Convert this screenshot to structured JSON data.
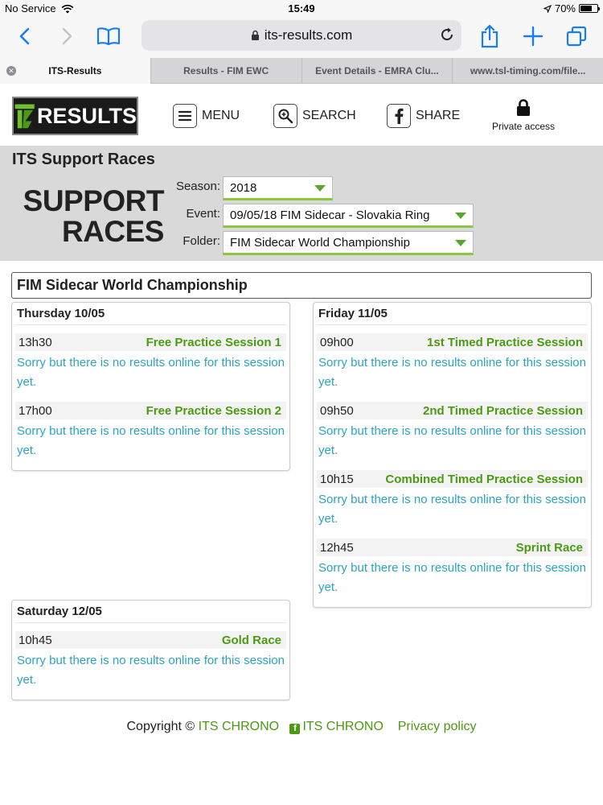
{
  "status_bar": {
    "carrier": "No Service",
    "time": "15:49",
    "battery": "70%",
    "battery_level": 0.7
  },
  "browser": {
    "url": "its-results.com",
    "tabs": [
      {
        "label": "ITS-Results",
        "active": true
      },
      {
        "label": "Results - FIM EWC",
        "active": false
      },
      {
        "label": "Event Details - EMRA Clu...",
        "active": false
      },
      {
        "label": "www.tsl-timing.com/file...",
        "active": false
      }
    ]
  },
  "header": {
    "logo_text": "RESULTS",
    "menu_label": "MENU",
    "search_label": "SEARCH",
    "share_label": "SHARE",
    "private_label": "Private access"
  },
  "section": {
    "title": "ITS Support Races",
    "big_title_line1": "SUPPORT",
    "big_title_line2": "RACES",
    "season_label": "Season:",
    "season_value": "2018",
    "event_label": "Event:",
    "event_value": "09/05/18 FIM Sidecar - Slovakia Ring",
    "folder_label": "Folder:",
    "folder_value": "FIM Sidecar World Championship"
  },
  "championship": "FIM Sidecar World Championship",
  "no_results_text": "Sorry but there is no results online for this session yet.",
  "days": {
    "thursday": {
      "title": "Thursday 10/05",
      "sessions": [
        {
          "time": "13h30",
          "name": "Free Practice Session 1",
          "message": "Sorry but there is no results online for this session yet."
        },
        {
          "time": "17h00",
          "name": "Free Practice Session 2",
          "message": "Sorry but there is no results online for this session yet."
        }
      ]
    },
    "friday": {
      "title": "Friday 11/05",
      "sessions": [
        {
          "time": "09h00",
          "name": "1st Timed Practice Session",
          "message": "Sorry but there is no results online for this session yet."
        },
        {
          "time": "09h50",
          "name": "2nd Timed Practice Session",
          "message": "Sorry but there is no results online for this session yet."
        },
        {
          "time": "10h15",
          "name": "Combined Timed Practice Session",
          "message": "Sorry but there is no results online for this session yet."
        },
        {
          "time": "12h45",
          "name": "Sprint Race",
          "message": "Sorry but there is no results online for this session yet."
        }
      ]
    },
    "saturday": {
      "title": "Saturday 12/05",
      "sessions": [
        {
          "time": "10h45",
          "name": "Gold Race",
          "message": "Sorry but there is no results online for this session yet."
        }
      ]
    }
  },
  "footer": {
    "copyright": "Copyright ©",
    "link1": "ITS CHRONO",
    "link2": "ITS CHRONO",
    "link3": "Privacy policy"
  },
  "colors": {
    "accent_green": "#4c9a13",
    "message_blue": "#2aa3c4",
    "select_underline": "#8dc63f",
    "ios_blue": "#1a7cf5"
  }
}
